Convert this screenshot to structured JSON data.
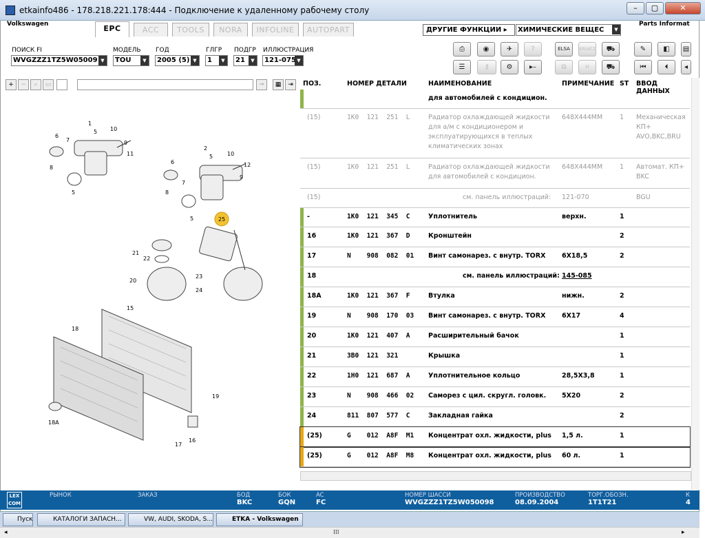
{
  "window": {
    "title": "etkainfo486 - 178.218.221.178:444 - Подключение к удаленному рабочему столу"
  },
  "app": {
    "brand": "Volkswagen",
    "right_label": "Parts Informat",
    "tabs": [
      "EPC",
      "ACC",
      "TOOLS",
      "NORA",
      "INFOLINE",
      "AUTOPART"
    ],
    "menu_other": "ДРУГИЕ ФУНКЦИИ ▸",
    "menu_chem": "ХИМИЧЕСКИЕ ВЕЩЕС"
  },
  "filters": {
    "search_label": "ПОИСК FI",
    "search_value": "WVGZZZ1TZ5W05009",
    "model_label": "МОДЕЛЬ",
    "model_value": "TOU",
    "year_label": "ГОД",
    "year_value": "2005 (5)",
    "mg_label": "ГЛГР",
    "mg_value": "1",
    "sg_label": "ПОДГР",
    "sg_value": "21",
    "ill_label": "ИЛЛЮСТРАЦИЯ",
    "ill_value": "121-075"
  },
  "table": {
    "headers": {
      "pos": "ПОЗ.",
      "part": "НОМЕР ДЕТАЛИ",
      "name": "НАИМЕНОВАНИЕ",
      "note": "ПРИМЕЧАНИЕ",
      "st": "ST",
      "input": "ВВОД ДАННЫХ"
    },
    "rows": [
      {
        "pos": "",
        "part": "",
        "name": "для автомобилей с кондицион.",
        "note": "",
        "st": "",
        "extra": "",
        "gray": false,
        "mark": "#8fb44a"
      },
      {
        "pos": "(15)",
        "part": "1K0  121  251  L",
        "name": "Радиатор охлаждающей жидкости\nдля а/м с кондиционером и\nэксплуатирующихся в теплых\nклиматических зонах",
        "note": "648X444MM",
        "st": "1",
        "extra": "Механическая\nКП+\nAVO,BKC,BRU",
        "gray": true,
        "mark": ""
      },
      {
        "pos": "(15)",
        "part": "1K0  121  251  L",
        "name": "Радиатор охлаждающей жидкости\nдля автомобилей с кондицион.",
        "note": "648X444MM",
        "st": "1",
        "extra": "Автомат. КП+\nBKC",
        "gray": true,
        "mark": ""
      },
      {
        "pos": "(15)",
        "part": "",
        "name": "см. панель иллюстраций:",
        "note": "121-070",
        "st": "",
        "extra": "BGU",
        "gray": true,
        "mark": "",
        "ref": true
      },
      {
        "pos": "-",
        "part": "1K0  121  345  C",
        "name": "Уплотнитель",
        "note": "верхн.",
        "st": "1",
        "extra": "",
        "gray": false,
        "mark": "#8fb44a"
      },
      {
        "pos": "16",
        "part": "1K0  121  367  D",
        "name": "Кронштейн",
        "note": "",
        "st": "2",
        "extra": "",
        "gray": false,
        "mark": "#8fb44a"
      },
      {
        "pos": "17",
        "part": "N    908  082  01",
        "name": "Винт самонарез. с внутр. TORX",
        "note": "6X18,5",
        "st": "2",
        "extra": "",
        "gray": false,
        "mark": "#8fb44a"
      },
      {
        "pos": "18",
        "part": "",
        "name": "см. панель иллюстраций:",
        "note": "145-085",
        "st": "",
        "extra": "",
        "gray": false,
        "mark": "#8fb44a",
        "ref": true
      },
      {
        "pos": "18A",
        "part": "1K0  121  367  F",
        "name": "Втулка",
        "note": "нижн.",
        "st": "2",
        "extra": "",
        "gray": false,
        "mark": "#8fb44a"
      },
      {
        "pos": "19",
        "part": "N    908  170  03",
        "name": "Винт самонарез. с внутр. TORX",
        "note": "6X17",
        "st": "4",
        "extra": "",
        "gray": false,
        "mark": "#8fb44a"
      },
      {
        "pos": "20",
        "part": "1K0  121  407  A",
        "name": "Расширительный бачок",
        "note": "",
        "st": "1",
        "extra": "",
        "gray": false,
        "mark": "#8fb44a"
      },
      {
        "pos": "21",
        "part": "3B0  121  321",
        "name": "Крышка",
        "note": "",
        "st": "1",
        "extra": "",
        "gray": false,
        "mark": "#8fb44a"
      },
      {
        "pos": "22",
        "part": "1H0  121  687  A",
        "name": "Уплотнительное кольцо",
        "note": "28,5X3,8",
        "st": "1",
        "extra": "",
        "gray": false,
        "mark": "#8fb44a"
      },
      {
        "pos": "23",
        "part": "N    908  466  02",
        "name": "Саморез с цил. скругл. головк.",
        "note": "5X20",
        "st": "2",
        "extra": "",
        "gray": false,
        "mark": "#8fb44a"
      },
      {
        "pos": "24",
        "part": "811  807  577  C",
        "name": "Закладная гайка",
        "note": "",
        "st": "2",
        "extra": "",
        "gray": false,
        "mark": "#8fb44a"
      },
      {
        "pos": "(25)",
        "part": "G    012  A8F  M1",
        "name": "Концентрат охл. жидкости, plus",
        "note": "1,5 л.",
        "st": "1",
        "extra": "",
        "gray": false,
        "mark": "#e6a817"
      },
      {
        "pos": "(25)",
        "part": "G    012  A8F  M8",
        "name": "Концентрат охл. жидкости, plus",
        "note": "60 л.",
        "st": "1",
        "extra": "",
        "gray": false,
        "mark": "#e6a817"
      }
    ]
  },
  "status": {
    "logo": "LEX\nCOM",
    "market_label": "РЫНОК",
    "order_label": "ЗАКАЗ",
    "bod_label": "БОД",
    "bod_value": "BKC",
    "bok_label": "БОК",
    "bok_value": "GQN",
    "ac_label": "AC",
    "ac_value": "FC",
    "chassis_label": "НОМЕР ШАССИ",
    "chassis_value": "WVGZZZ1TZ5W050098",
    "prod_label": "ПРОИЗВОДСТВО",
    "prod_value": "08.09.2004",
    "torg_label": "ТОРГ.ОБОЗН.",
    "torg_value": "1T1T21",
    "k_label": "К",
    "k_value": "4"
  },
  "taskbar": [
    "Пуск",
    "КАТАЛОГИ ЗАПАСН...",
    "VW, AUDI, SKODA, S...",
    "ETKA - Volkswagen"
  ],
  "callouts": [
    "1",
    "5",
    "6",
    "7",
    "8",
    "5",
    "9",
    "10",
    "11",
    "2",
    "5",
    "6",
    "10",
    "12",
    "7",
    "9",
    "8",
    "5",
    "25",
    "21",
    "22",
    "20",
    "23",
    "24",
    "15",
    "18",
    "19",
    "18A",
    "17",
    "16"
  ],
  "colors": {
    "accent_bar": "#0f5f9e",
    "group_mark": "#8fb44a",
    "acc_mark": "#e6a817"
  }
}
